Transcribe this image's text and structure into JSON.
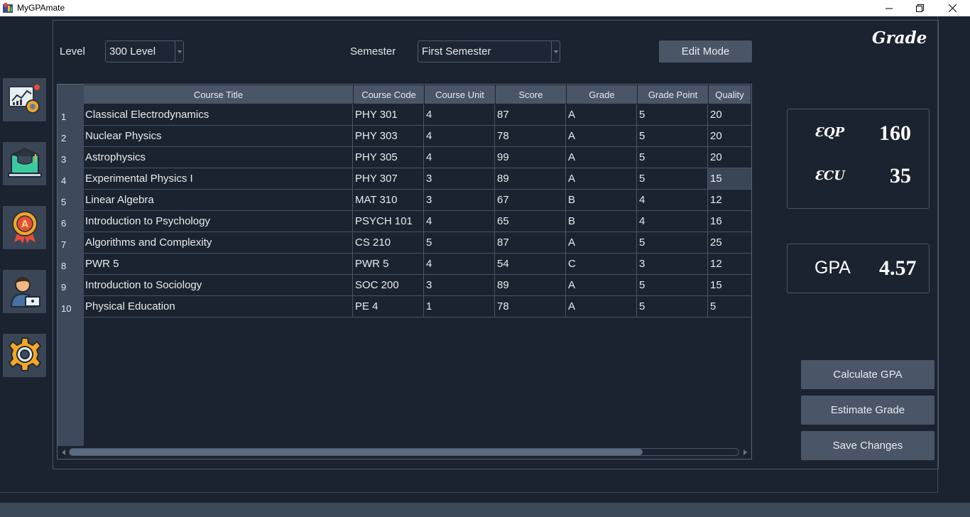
{
  "window": {
    "title": "MyGPAmate",
    "icons": {
      "app": "app-logo-icon",
      "minimize": "minimize-icon",
      "restore": "restore-icon",
      "close": "close-icon"
    }
  },
  "sidebar": {
    "items": [
      {
        "name": "dashboard",
        "icon": "dashboard-chart-icon"
      },
      {
        "name": "courses",
        "icon": "graduation-laptop-icon"
      },
      {
        "name": "grades",
        "icon": "award-badge-icon"
      },
      {
        "name": "profile",
        "icon": "user-laptop-icon"
      },
      {
        "name": "settings",
        "icon": "gear-icon"
      }
    ]
  },
  "filters": {
    "level_label": "Level",
    "level_value": "300 Level",
    "semester_label": "Semester",
    "semester_value": "First Semester",
    "edit_mode_label": "Edit Mode"
  },
  "heading": "Grade",
  "table": {
    "columns": [
      "Course Title",
      "Course Code",
      "Course Unit",
      "Score",
      "Grade",
      "Grade Point",
      "Quality"
    ],
    "rows": [
      {
        "num": "1",
        "cells": [
          "Classical Electrodynamics",
          "PHY 301",
          "4",
          "87",
          "A",
          "5",
          "20"
        ]
      },
      {
        "num": "2",
        "cells": [
          "Nuclear Physics",
          "PHY 303",
          "4",
          "78",
          "A",
          "5",
          "20"
        ]
      },
      {
        "num": "3",
        "cells": [
          "Astrophysics",
          "PHY 305",
          "4",
          "99",
          "A",
          "5",
          "20"
        ]
      },
      {
        "num": "4",
        "cells": [
          "Experimental Physics I",
          "PHY 307",
          "3",
          "89",
          "A",
          "5",
          "15"
        ]
      },
      {
        "num": "5",
        "cells": [
          "Linear Algebra",
          "MAT 310",
          "3",
          "67",
          "B",
          "4",
          "12"
        ]
      },
      {
        "num": "6",
        "cells": [
          "Introduction to Psychology",
          "PSYCH 101",
          "4",
          "65",
          "B",
          "4",
          "16"
        ]
      },
      {
        "num": "7",
        "cells": [
          "Algorithms and Complexity",
          "CS 210",
          "5",
          "87",
          "A",
          "5",
          "25"
        ]
      },
      {
        "num": "8",
        "cells": [
          "PWR 5",
          "PWR 5",
          "4",
          "54",
          "C",
          "3",
          "12"
        ]
      },
      {
        "num": "9",
        "cells": [
          "Introduction to Sociology",
          "SOC 200",
          "3",
          "89",
          "A",
          "5",
          "15"
        ]
      },
      {
        "num": "10",
        "cells": [
          "Physical Education",
          "PE 4",
          "1",
          "78",
          "A",
          "5",
          "5"
        ]
      }
    ],
    "selected_cell": {
      "row": 3,
      "col": 6
    }
  },
  "stats": {
    "eqp_label": "ƐQP",
    "eqp_value": "160",
    "ecu_label": "ƐCU",
    "ecu_value": "35",
    "gpa_label": "GPA",
    "gpa_value": "4.57"
  },
  "actions": {
    "calculate_label": "Calculate GPA",
    "estimate_label": "Estimate Grade",
    "save_label": "Save Changes"
  },
  "colors": {
    "background": "#1b2330",
    "panel_button": "#4a5568",
    "header": "#4a5568",
    "accent_orange": "#f5a623"
  }
}
